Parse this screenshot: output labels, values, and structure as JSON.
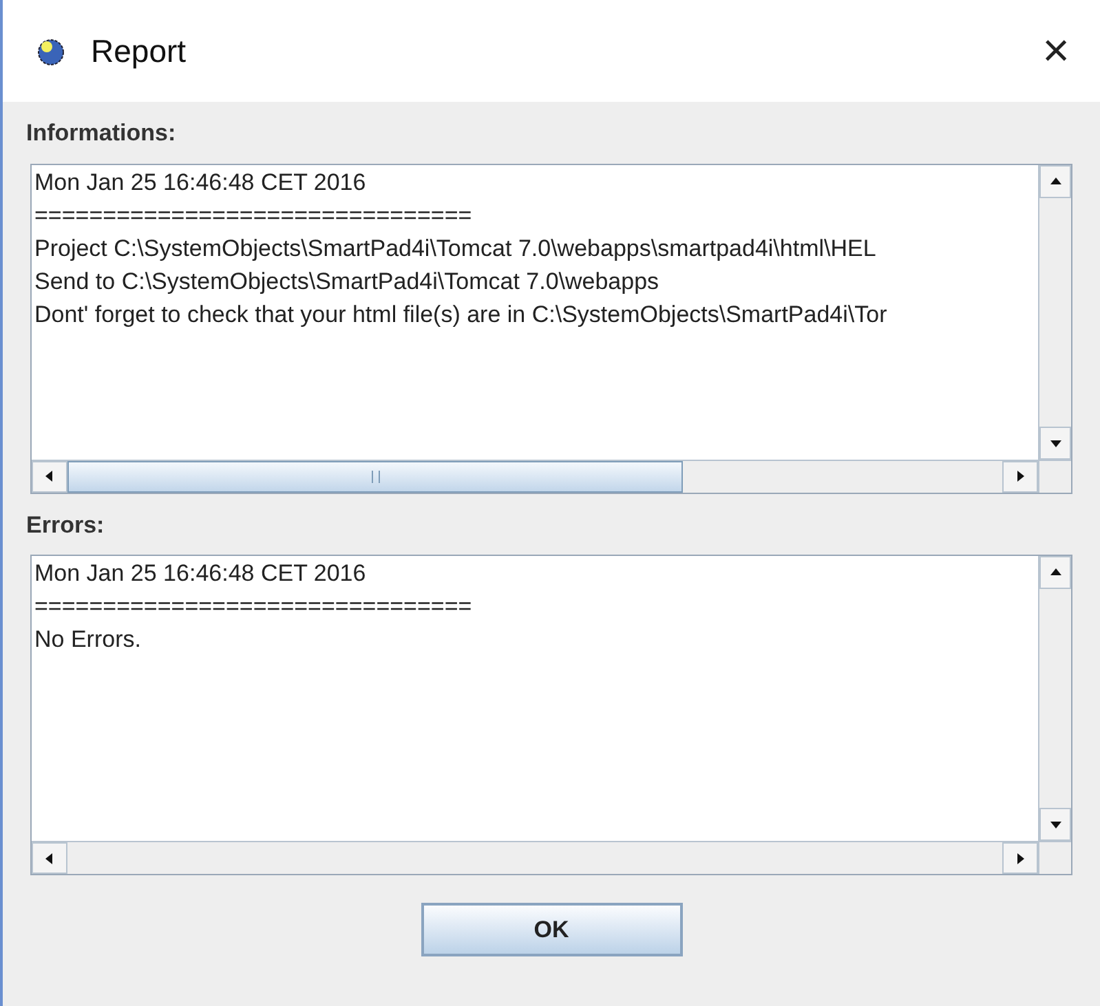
{
  "window": {
    "title": "Report",
    "close": "×"
  },
  "informations": {
    "label": "Informations:",
    "lines": [
      "Mon Jan 25 16:46:48 CET 2016",
      "================================",
      "Project C:\\SystemObjects\\SmartPad4i\\Tomcat 7.0\\webapps\\smartpad4i\\html\\HEL",
      "Send to C:\\SystemObjects\\SmartPad4i\\Tomcat 7.0\\webapps",
      "Dont' forget to check that your html file(s) are in C:\\SystemObjects\\SmartPad4i\\Tor"
    ]
  },
  "errors": {
    "label": "Errors:",
    "lines": [
      "Mon Jan 25 16:46:48 CET 2016",
      "================================",
      "No Errors."
    ]
  },
  "buttons": [
    "OK"
  ]
}
